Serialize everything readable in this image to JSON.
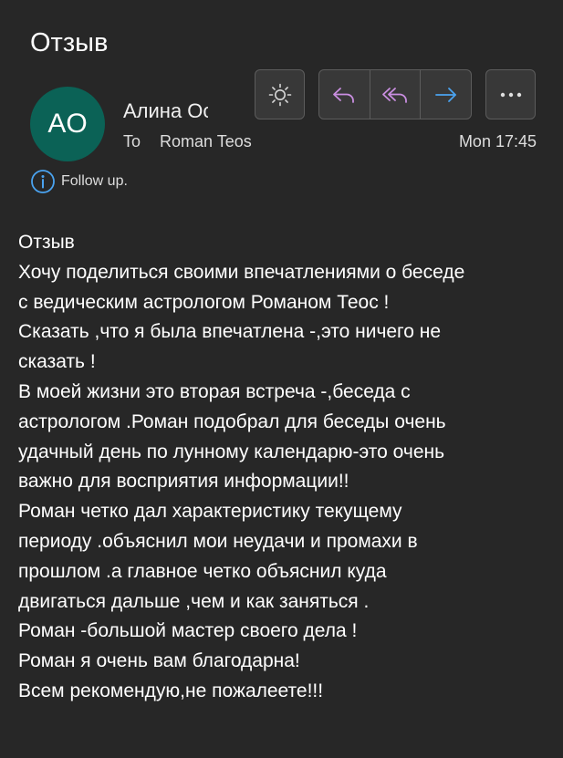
{
  "message": {
    "subject": "Отзыв",
    "avatar_initials": "AO",
    "sender_name": "Алина Осипова",
    "to_label": "To",
    "recipient": "Roman Teos",
    "timestamp": "Mon 17:45",
    "flag_text": "Follow up."
  },
  "toolbar": {
    "theme_icon": "sun-icon",
    "reply_icon": "reply-icon",
    "reply_all_icon": "reply-all-icon",
    "forward_icon": "forward-arrow-icon",
    "more_icon": "more-icon"
  },
  "colors": {
    "background": "#272727",
    "avatar": "#0b6256",
    "reply_accent": "#c98ee0",
    "forward_accent": "#4aa3f0",
    "info_accent": "#4aa3f0"
  },
  "body_lines": [
    "Отзыв",
    "Хочу поделиться своими впечатлениями о беседе",
    "с ведическим астрологом Романом Теос !",
    "Сказать ,что я была впечатлена -,это ничего не",
    "сказать !",
    "В моей жизни это вторая встреча -,беседа с",
    "астрологом .Роман подобрал для беседы очень",
    "удачный день по лунному календарю-это очень",
    "важно для восприятия информации!!",
    "Роман четко дал характеристику текущему",
    "периоду .объяснил мои неудачи и промахи в",
    "прошлом .а главное четко объяснил куда",
    "двигаться дальше ,чем и как заняться .",
    "Роман -большой мастер своего дела !",
    "Роман я очень вам благодарна!",
    "Всем рекомендую,не пожалеете!!!"
  ]
}
